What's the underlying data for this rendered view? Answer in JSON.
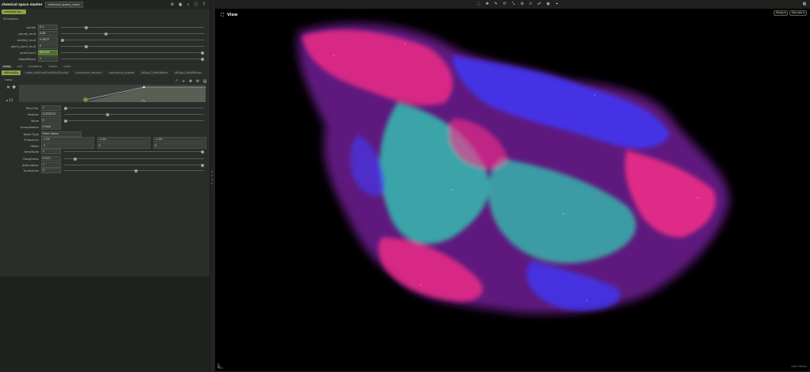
{
  "node": {
    "type_label": "chemical space master",
    "name": "chemical_space_cloud",
    "tag": "chemical sp...",
    "section": "Simulation"
  },
  "top_params": [
    {
      "label": "pscale",
      "value": "0.1",
      "fraction": 0.17
    },
    {
      "label": "pscale_mult",
      "value": "0.86",
      "fraction": 0.31
    },
    {
      "label": "emitter_mult",
      "value": "0.0625",
      "fraction": 0.0
    },
    {
      "label": "point_count_mult",
      "value": "0",
      "fraction": 0.17
    },
    {
      "label": "pointCount",
      "value": "640000",
      "fraction": 1.0
    },
    {
      "label": "AlphaRation",
      "value": "1",
      "fraction": 1.0
    }
  ],
  "tabs": [
    "ramp",
    "call",
    "transform",
    "Cache",
    "color"
  ],
  "active_tab": "ramp",
  "subtabs": [
    "v0BuildDig",
    "noise_dist0mp0OutSlimDGpulte",
    "turbulence_amount",
    "turbulence_shapes",
    "dfDisp2_Mod0Noise",
    "dfDisp3_Mod0Noise"
  ],
  "active_subtab": "v0BuildDig",
  "ramp": {
    "label": "ramp",
    "point_index": "▸ 11"
  },
  "point_params": [
    {
      "label": "Point No.",
      "value": "1"
    },
    {
      "label": "Position",
      "value": "0.005210"
    },
    {
      "label": "Value",
      "value": "0"
    },
    {
      "label": "Interpolation",
      "value": "Linear"
    }
  ],
  "noise": {
    "noise_type_label": "Noise Type",
    "noise_type": "Perlin Noise",
    "frequency_label": "Frequency",
    "frequency": [
      "-1.59",
      "-1.59",
      "-1.59"
    ],
    "offset_label": "Offset",
    "offset": [
      "-1",
      "0",
      "0"
    ],
    "amplitude_label": "Amplitude",
    "amplitude": "1",
    "roughness_label": "Roughness",
    "roughness": "0.015",
    "attenuation_label": "Attenuation",
    "attenuation": "1",
    "turbulence_label": "Turbulence",
    "turbulence": "5"
  },
  "viewer": {
    "title": "View",
    "btn_persp": "Persp ▾",
    "btn_cam": "No cam ▾",
    "footer": "Indie Edition"
  },
  "colors": {
    "accent": "#8ea545",
    "cloud_pink": "#ff2f8a",
    "cloud_blue": "#3f3aff",
    "cloud_teal": "#2fd3b5"
  }
}
